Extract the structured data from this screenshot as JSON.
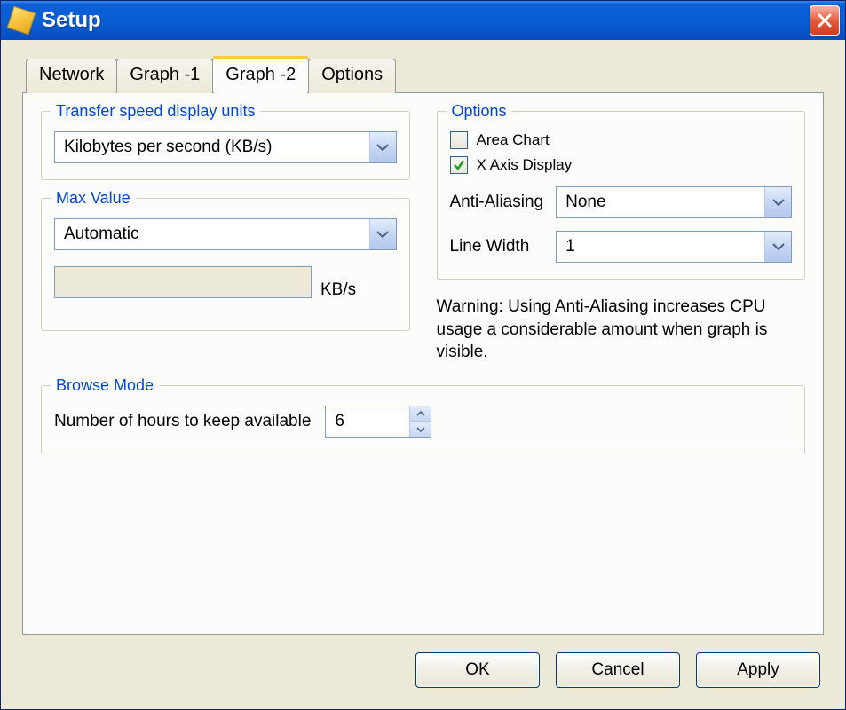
{
  "window": {
    "title": "Setup"
  },
  "tabs": [
    {
      "label": "Network"
    },
    {
      "label": "Graph -1"
    },
    {
      "label": "Graph -2"
    },
    {
      "label": "Options"
    }
  ],
  "transferSpeed": {
    "legend": "Transfer speed display units",
    "value": "Kilobytes per second (KB/s)"
  },
  "maxValue": {
    "legend": "Max Value",
    "mode": "Automatic",
    "customValue": "",
    "unitSuffix": "KB/s"
  },
  "options": {
    "legend": "Options",
    "areaChart": {
      "label": "Area Chart",
      "checked": false
    },
    "xAxisDisplay": {
      "label": "X Axis Display",
      "checked": true
    },
    "antiAliasing": {
      "label": "Anti-Aliasing",
      "value": "None"
    },
    "lineWidth": {
      "label": "Line Width",
      "value": "1"
    },
    "warning": "Warning: Using Anti-Aliasing increases CPU usage a considerable amount when graph is visible."
  },
  "browseMode": {
    "legend": "Browse Mode",
    "label": "Number of hours to keep available",
    "value": "6"
  },
  "buttons": {
    "ok": "OK",
    "cancel": "Cancel",
    "apply": "Apply"
  }
}
